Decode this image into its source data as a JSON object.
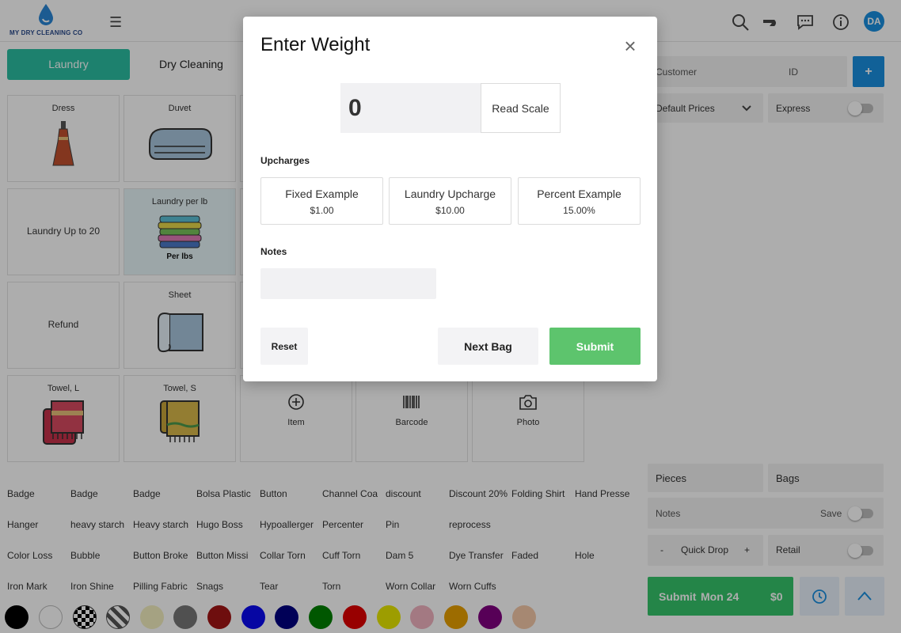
{
  "header": {
    "logo_text": "MY DRY CLEANING CO",
    "avatar_initials": "DA",
    "icons": [
      "menu-icon",
      "search-icon",
      "delivery-icon",
      "chat-icon",
      "info-icon"
    ]
  },
  "tabs": [
    {
      "label": "Laundry",
      "active": true
    },
    {
      "label": "Dry Cleaning",
      "active": false
    }
  ],
  "products": [
    {
      "label": "Dress",
      "icon": "dress-icon"
    },
    {
      "label": "Duvet",
      "icon": "duvet-icon"
    },
    {
      "label": "Laundry Up to 20",
      "icon": ""
    },
    {
      "label": "Laundry per lb",
      "icon": "folded-laundry-icon",
      "sub": "Per lbs"
    },
    {
      "label": "Refund",
      "icon": ""
    },
    {
      "label": "Sheet",
      "icon": "sheet-icon"
    },
    {
      "label": "Towel, L",
      "icon": "towel-large-icon"
    },
    {
      "label": "Towel, S",
      "icon": "towel-small-icon"
    },
    {
      "label": "Item",
      "icon": "add-circle-icon"
    },
    {
      "label": "Barcode",
      "icon": "barcode-icon"
    },
    {
      "label": "Photo",
      "icon": "camera-icon"
    }
  ],
  "chips": [
    [
      "Badge",
      "Badge",
      "Badge",
      "Bolsa Plastic",
      "Button",
      "Channel Coa",
      "discount",
      "Discount 20%",
      "Folding Shirt",
      "Hand Presse"
    ],
    [
      "Hanger",
      "heavy starch",
      "Heavy starch",
      "Hugo Boss",
      "Hypoallerger",
      "Percenter",
      "Pin",
      "reprocess"
    ],
    [
      "Color Loss",
      "Bubble",
      "Button Broke",
      "Button Missi",
      "Collar Torn",
      "Cuff Torn",
      "Dam 5",
      "Dye Transfer",
      "Faded",
      "Hole"
    ],
    [
      "Iron Mark",
      "Iron Shine",
      "Pilling Fabric",
      "Snags",
      "Tear",
      "Torn",
      "Worn Collar",
      "Worn Cuffs"
    ]
  ],
  "colors": [
    "#000000",
    "#ffffff",
    "checker",
    "stripe",
    "#f3efc0",
    "#777777",
    "#a31515",
    "#0a0af0",
    "#000080",
    "#008000",
    "#e00000",
    "#e8e800",
    "#f0b3c0",
    "#e8a000",
    "#800080",
    "#f5c9a8"
  ],
  "right_panel": {
    "customer_placeholder": "Customer",
    "id_placeholder": "ID",
    "add_label": "+",
    "price_list": "Default Prices",
    "express_label": "Express",
    "pieces_placeholder": "Pieces",
    "bags_placeholder": "Bags",
    "notes_placeholder": "Notes",
    "save_label": "Save",
    "quick_drop": {
      "minus": "-",
      "label": "Quick Drop",
      "plus": "+"
    },
    "retail_label": "Retail",
    "submit": {
      "label": "Submit",
      "date": "Mon 24",
      "amount": "$0"
    }
  },
  "modal": {
    "title": "Enter Weight",
    "weight_value": "0",
    "read_scale_label": "Read Scale",
    "upcharges_label": "Upcharges",
    "upcharges": [
      {
        "name": "Fixed Example",
        "value": "$1.00"
      },
      {
        "name": "Laundry Upcharge",
        "value": "$10.00"
      },
      {
        "name": "Percent Example",
        "value": "15.00%"
      }
    ],
    "notes_label": "Notes",
    "notes_value": "",
    "reset_label": "Reset",
    "next_bag_label": "Next Bag",
    "submit_label": "Submit"
  }
}
